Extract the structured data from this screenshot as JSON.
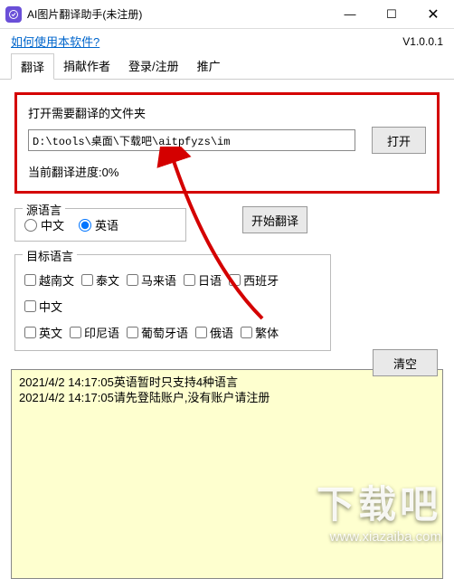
{
  "window": {
    "title": "AI图片翻译助手(未注册)"
  },
  "help_link": "如何使用本软件?",
  "version": "V1.0.0.1",
  "tabs": [
    "翻译",
    "捐献作者",
    "登录/注册",
    "推广"
  ],
  "folder": {
    "label": "打开需要翻译的文件夹",
    "path": "D:\\tools\\桌面\\下载吧\\aitpfyzs\\im",
    "open_btn": "打开",
    "progress": "当前翻译进度:0%"
  },
  "source_lang": {
    "legend": "源语言",
    "options": [
      "中文",
      "英语"
    ]
  },
  "start_btn": "开始翻译",
  "target_lang": {
    "legend": "目标语言",
    "row1": [
      "越南文",
      "泰文",
      "马来语",
      "日语",
      "西班牙",
      "中文"
    ],
    "row2": [
      "英文",
      "印尼语",
      "葡萄牙语",
      "俄语",
      "繁体"
    ]
  },
  "clear_btn": "清空",
  "log": {
    "line1": "2021/4/2 14:17:05英语暂时只支持4种语言",
    "line2": "2021/4/2 14:17:05请先登陆账户,没有账户请注册"
  },
  "watermark": {
    "big": "下载吧",
    "url": "www.xiazaiba.com"
  }
}
